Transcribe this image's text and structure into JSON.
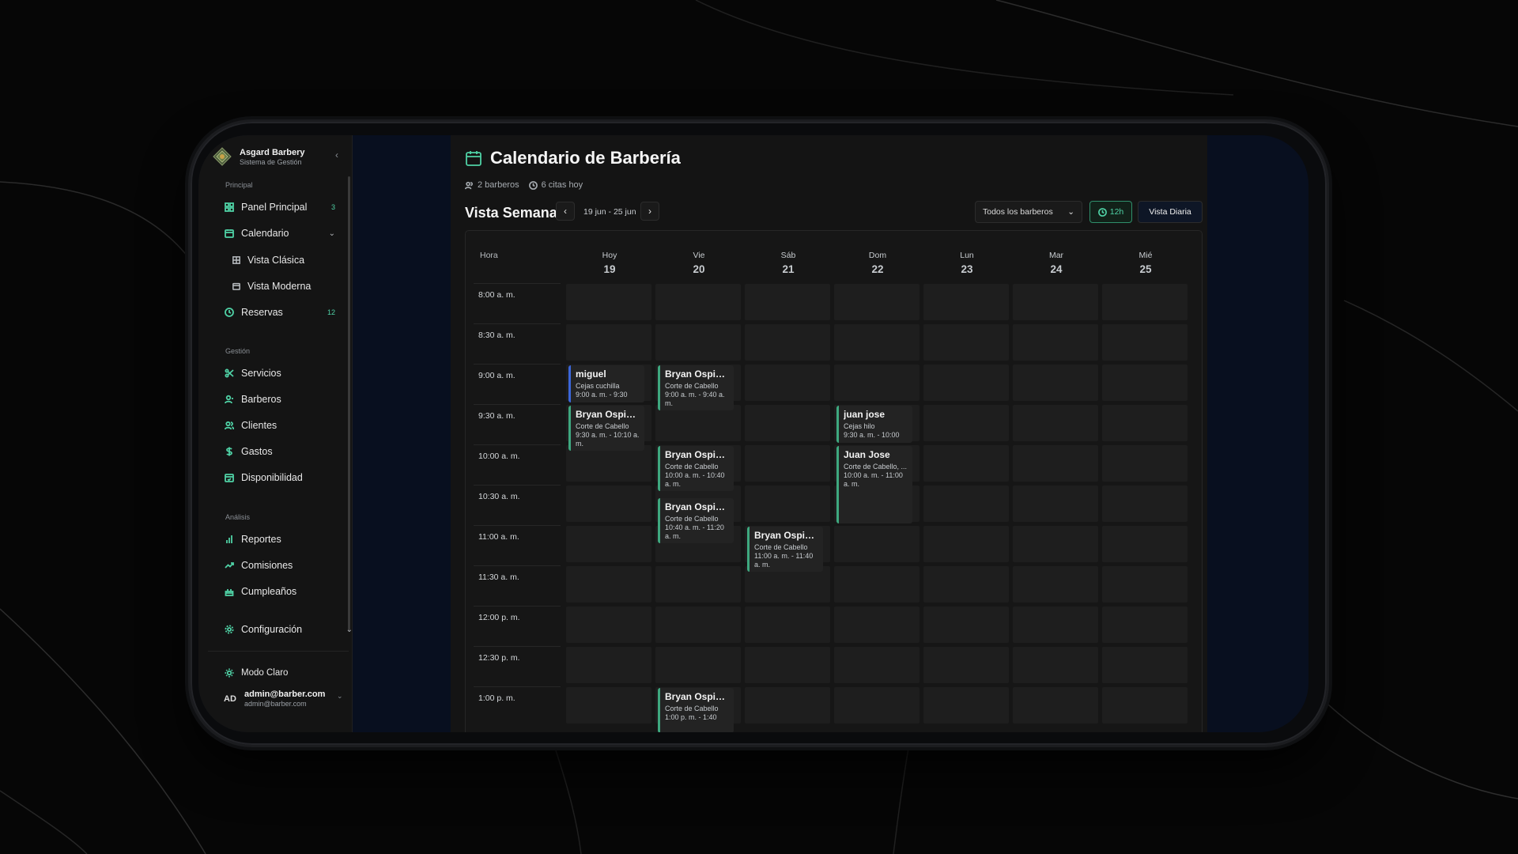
{
  "brand": {
    "title": "Asgard Barbery",
    "subtitle": "Sistema de Gestión"
  },
  "sidebar": {
    "sections": {
      "principal": "Principal",
      "gestion": "Gestión",
      "analisis": "Análisis"
    },
    "items": [
      {
        "label": "Panel Principal",
        "badge": "3",
        "icon": "grid-icon"
      },
      {
        "label": "Calendario",
        "icon": "calendar-icon"
      },
      {
        "label": "Vista Clásica",
        "icon": "grid-icon"
      },
      {
        "label": "Vista Moderna",
        "icon": "calendar-icon"
      },
      {
        "label": "Reservas",
        "badge": "12",
        "icon": "clock-icon"
      },
      {
        "label": "Servicios",
        "icon": "scissors-icon"
      },
      {
        "label": "Barberos",
        "icon": "user-icon"
      },
      {
        "label": "Clientes",
        "icon": "users-icon"
      },
      {
        "label": "Gastos",
        "icon": "dollar-icon"
      },
      {
        "label": "Disponibilidad",
        "icon": "calendar-check-icon"
      },
      {
        "label": "Reportes",
        "icon": "bar-chart-icon"
      },
      {
        "label": "Comisiones",
        "icon": "trend-icon"
      },
      {
        "label": "Cumpleaños",
        "icon": "cake-icon"
      },
      {
        "label": "Configuración",
        "icon": "gear-icon"
      }
    ],
    "mode": "Modo Claro",
    "user": {
      "initials": "AD",
      "name": "admin@barber.com",
      "email": "admin@barber.com"
    }
  },
  "main": {
    "title": "Calendario de Barbería",
    "barbers_count": "2 barberos",
    "appointments_today": "6 citas hoy",
    "view_title": "Vista Semanal",
    "range": "19 jun - 25 jun",
    "filter": "Todos los barberos",
    "hour_format": "12h",
    "daily_view": "Vista Diaria"
  },
  "calendar": {
    "hour_header": "Hora",
    "days": [
      {
        "name": "Hoy",
        "date": "19"
      },
      {
        "name": "Vie",
        "date": "20"
      },
      {
        "name": "Sáb",
        "date": "21"
      },
      {
        "name": "Dom",
        "date": "22"
      },
      {
        "name": "Lun",
        "date": "23"
      },
      {
        "name": "Mar",
        "date": "24"
      },
      {
        "name": "Mié",
        "date": "25"
      }
    ],
    "times": [
      "8:00 a. m.",
      "8:30 a. m.",
      "9:00 a. m.",
      "9:30 a. m.",
      "10:00 a. m.",
      "10:30 a. m.",
      "11:00 a. m.",
      "11:30 a. m.",
      "12:00 p. m.",
      "12:30 p. m.",
      "1:00 p. m."
    ],
    "events": [
      {
        "day": 0,
        "slot": 2,
        "span": 1,
        "name": "miguel",
        "service": "Cejas cuchilla",
        "time": "9:00 a. m. - 9:30",
        "color": "#3b66d9"
      },
      {
        "day": 0,
        "slot": 3,
        "span": 1.2,
        "name": "Bryan Ospin...",
        "service": "Corte de Cabello",
        "time": "9:30 a. m. - 10:10 a. m.",
        "color": "#3ea87f"
      },
      {
        "day": 1,
        "slot": 2,
        "span": 1.2,
        "name": "Bryan Ospin...",
        "service": "Corte de Cabello",
        "time": "9:00 a. m. - 9:40 a. m.",
        "color": "#3ea87f"
      },
      {
        "day": 1,
        "slot": 4,
        "span": 1.2,
        "name": "Bryan Ospin...",
        "service": "Corte de Cabello",
        "time": "10:00 a. m. - 10:40 a. m.",
        "color": "#3ea87f"
      },
      {
        "day": 1,
        "slot": 5.3,
        "span": 1.2,
        "name": "Bryan Ospin...",
        "service": "Corte de Cabello",
        "time": "10:40 a. m. - 11:20 a. m.",
        "color": "#3ea87f"
      },
      {
        "day": 2,
        "slot": 6,
        "span": 1.2,
        "name": "Bryan Ospin...",
        "service": "Corte de Cabello",
        "time": "11:00 a. m. - 11:40 a. m.",
        "color": "#3ea87f"
      },
      {
        "day": 3,
        "slot": 3,
        "span": 1,
        "name": "juan jose",
        "service": "Cejas hilo",
        "time": "9:30 a. m. - 10:00",
        "color": "#3ea87f"
      },
      {
        "day": 3,
        "slot": 4,
        "span": 2,
        "name": "Juan Jose",
        "service": "Corte de Cabello, ...",
        "time": "10:00 a. m. - 11:00 a. m.",
        "color": "#3ea87f"
      },
      {
        "day": 1,
        "slot": 10,
        "span": 1.2,
        "name": "Bryan Ospin...",
        "service": "Corte de Cabello",
        "time": "1:00 p. m. - 1:40",
        "color": "#3ea87f"
      }
    ]
  }
}
